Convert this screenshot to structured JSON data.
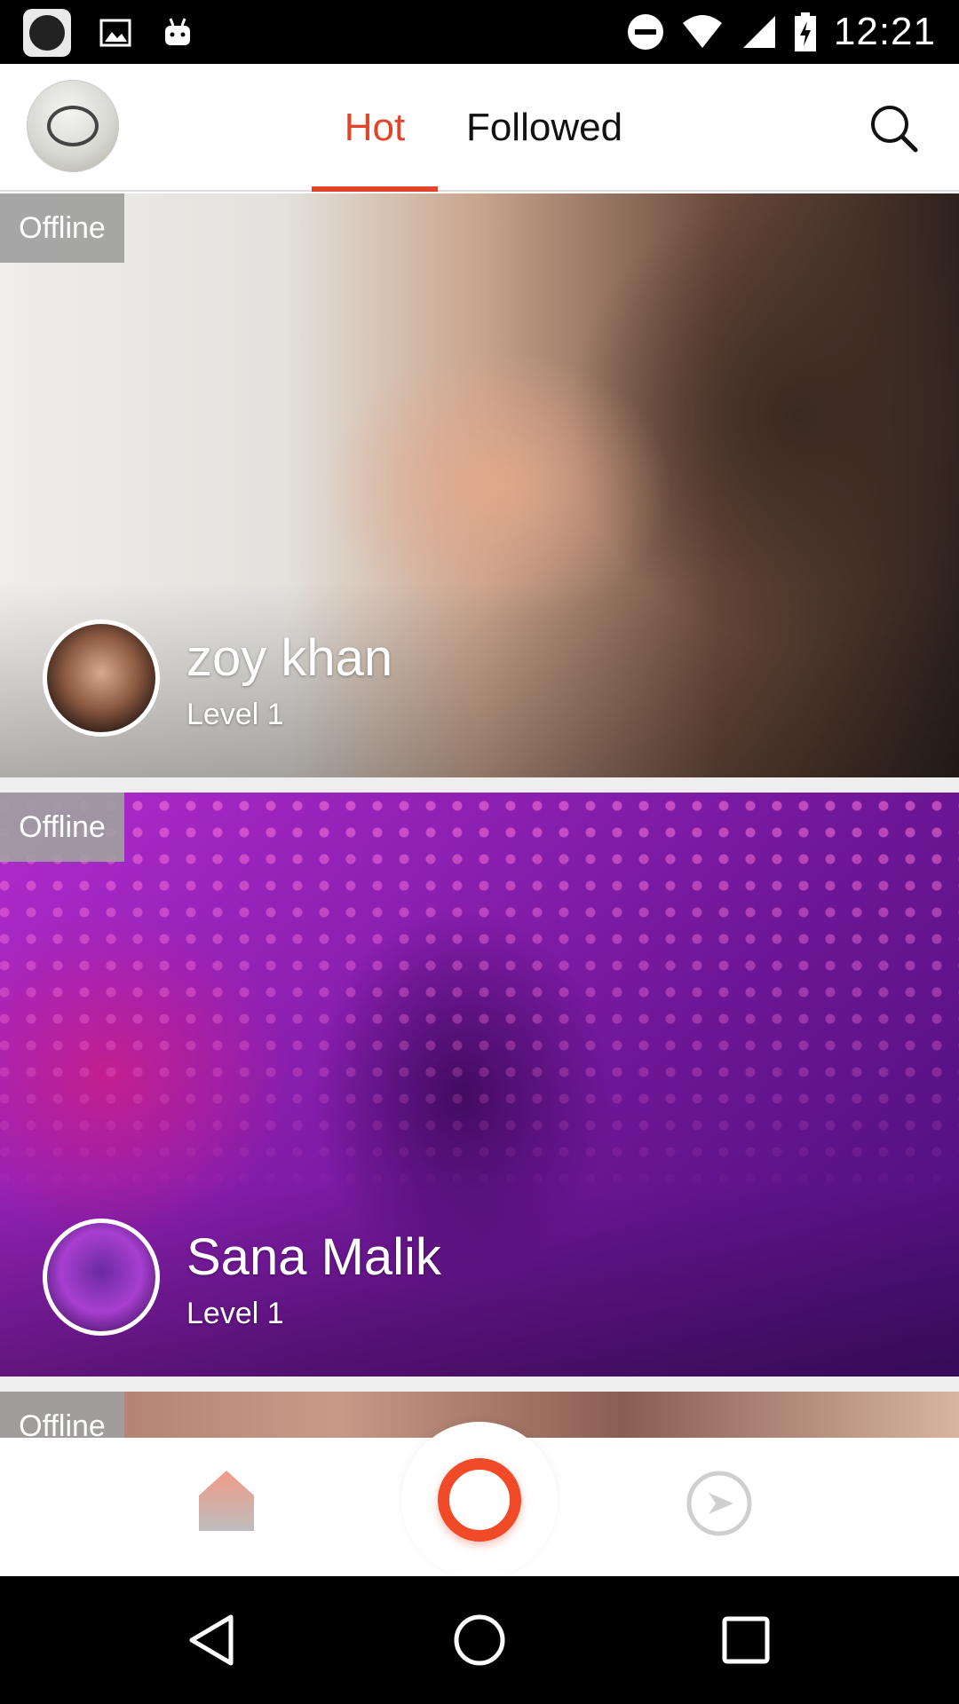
{
  "status_bar": {
    "time": "12:21",
    "icons": [
      "app-notification-icon",
      "image-icon",
      "android-icon",
      "do-not-disturb-icon",
      "wifi-icon",
      "cell-signal-icon",
      "battery-charging-icon"
    ]
  },
  "header": {
    "tabs": [
      {
        "label": "Hot",
        "active": true
      },
      {
        "label": "Followed",
        "active": false
      }
    ],
    "search_icon": "search-icon",
    "accent_color": "#e0452b"
  },
  "feed": {
    "cards": [
      {
        "status": "Offline",
        "name": "zoy khan",
        "level": "Level 1"
      },
      {
        "status": "Offline",
        "name": "Sana Malik",
        "level": "Level 1"
      },
      {
        "status": "Offline",
        "name": "",
        "level": ""
      }
    ]
  },
  "bottom_nav": {
    "items": [
      "home-icon",
      "go-live-icon",
      "explore-compass-icon"
    ],
    "live_color": "#f04a28"
  },
  "system_nav": {
    "items": [
      "back-icon",
      "home-circle-icon",
      "recent-apps-icon"
    ]
  }
}
